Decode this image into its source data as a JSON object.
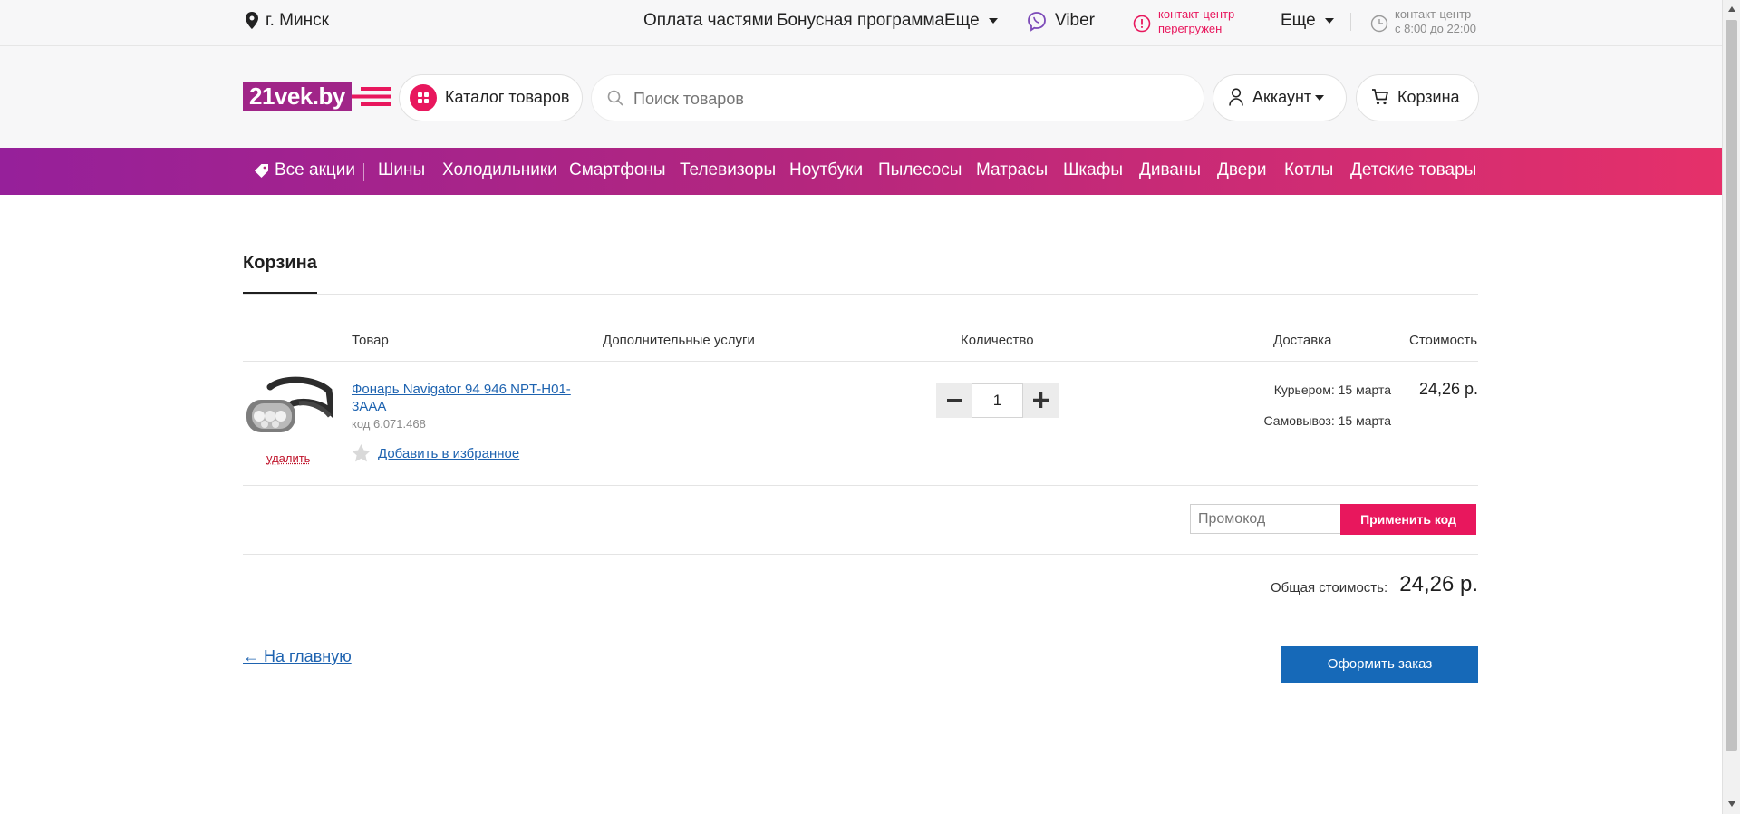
{
  "topbar": {
    "city": "г. Минск",
    "links": [
      "Оплата частями",
      "Бонусная программа"
    ],
    "more1": "Еще",
    "viber": "Viber",
    "contact_status": [
      "контакт-центр",
      "перегружен"
    ],
    "more2": "Еще",
    "hours": [
      "контакт-центр",
      "с 8:00 до 22:00"
    ]
  },
  "header": {
    "logo": "21vek.by",
    "catalog_label": "Каталог товаров",
    "search_placeholder": "Поиск товаров",
    "account_label": "Аккаунт",
    "cart_label": "Корзина"
  },
  "nav": {
    "promo": "Все акции",
    "items": [
      "Шины",
      "Холодильники",
      "Смартфоны",
      "Телевизоры",
      "Ноутбуки",
      "Пылесосы",
      "Матрасы",
      "Шкафы",
      "Диваны",
      "Двери",
      "Котлы",
      "Детские товары"
    ]
  },
  "cart": {
    "tab_title": "Корзина",
    "columns": {
      "product": "Товар",
      "services": "Дополнительные услуги",
      "quantity": "Количество",
      "delivery": "Доставка",
      "price": "Стоимость"
    },
    "item": {
      "name": "Фонарь Navigator 94 946 NPT-H01-3AAA",
      "code": "код 6.071.468",
      "remove_label": "удалить",
      "favorite_label": "Добавить в избранное",
      "quantity": "1",
      "courier": "Курьером: 15 марта",
      "pickup": "Самовывоз: 15 марта",
      "price": "24,26 р."
    },
    "promo_placeholder": "Промокод",
    "apply_label": "Применить код",
    "total_label": "Общая стоимость:",
    "total_value": "24,26 р.",
    "back_label": "← На главную",
    "checkout_label": "Оформить заказ"
  },
  "colors": {
    "accent_pink": "#e8175d",
    "nav_gradient_start": "#96209a",
    "nav_gradient_end": "#e5306a",
    "checkout_blue": "#1669b8",
    "link_blue": "#1e63b0"
  }
}
